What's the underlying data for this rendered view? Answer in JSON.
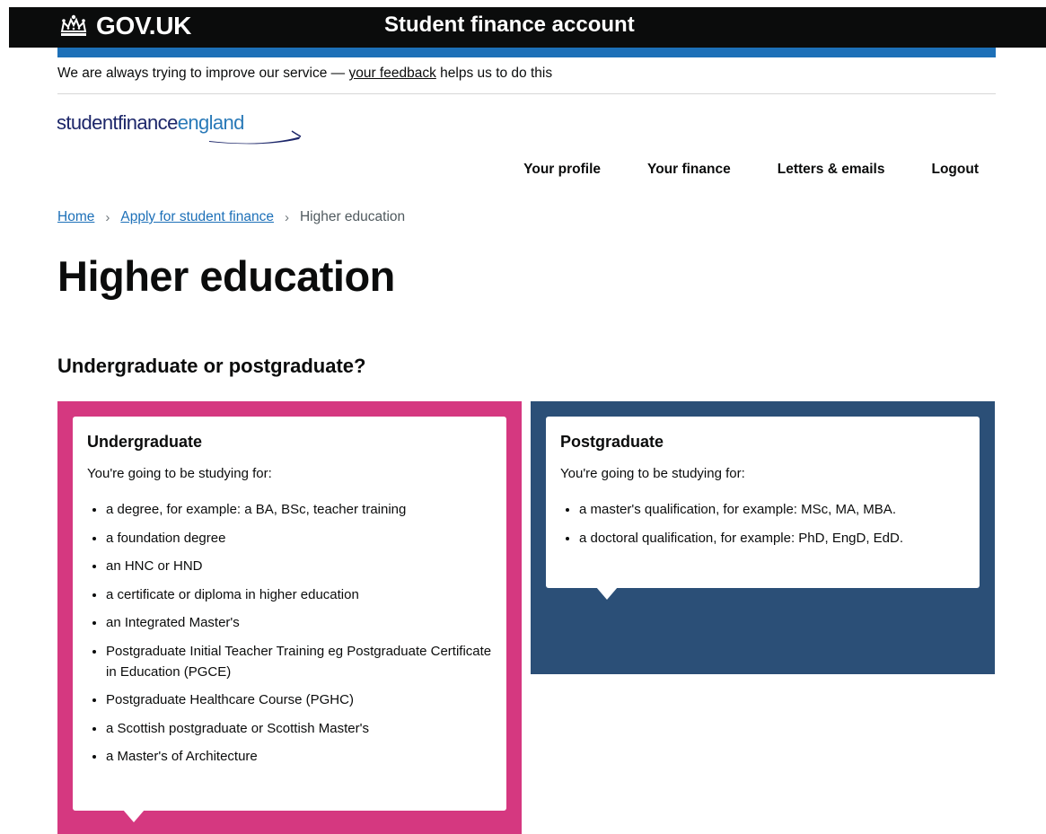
{
  "header": {
    "logo_text": "GOV.UK",
    "service_name": "Student finance account"
  },
  "feedback": {
    "before": "We are always trying to improve our service — ",
    "link": "your feedback",
    "after": " helps us to do this"
  },
  "brand": {
    "word1": "studentfinance",
    "word2": "england"
  },
  "nav": {
    "items": [
      "Your profile",
      "Your finance",
      "Letters & emails",
      "Logout"
    ]
  },
  "breadcrumb": {
    "items": [
      "Home",
      "Apply for student finance"
    ],
    "current": "Higher education"
  },
  "page_title": "Higher education",
  "section_heading": "Undergraduate or postgraduate?",
  "options": [
    {
      "title": "Undergraduate",
      "intro": "You're going to be studying for:",
      "items": [
        "a degree, for example: a BA, BSc, teacher training",
        "a foundation degree",
        "an HNC or HND",
        "a certificate or diploma in higher education",
        "an Integrated Master's",
        "Postgraduate Initial Teacher Training eg Postgraduate Certificate in Education (PGCE)",
        "Postgraduate Healthcare Course (PGHC)",
        "a Scottish postgraduate or Scottish Master's",
        "a Master's of Architecture"
      ]
    },
    {
      "title": "Postgraduate",
      "intro": "You're going to be studying for:",
      "items": [
        "a master's qualification, for example: MSc, MA, MBA.",
        "a doctoral qualification, for example: PhD, EngD, EdD."
      ]
    }
  ],
  "colors": {
    "undergraduate_panel": "#d53880",
    "postgraduate_panel": "#2b4f77",
    "header_black": "#0b0c0c",
    "govuk_blue": "#1d70b8",
    "brand_navy": "#1c2669",
    "brand_blue": "#2a7ab8"
  }
}
